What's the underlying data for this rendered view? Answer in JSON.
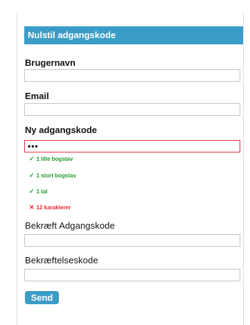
{
  "form": {
    "title": "Nulstil adgangskode",
    "fields": {
      "username_label": "Brugernavn",
      "username_value": "",
      "email_label": "Email",
      "email_value": "",
      "new_password_label": "Ny adgangskode",
      "new_password_value": "•••",
      "confirm_password_label": "Bekræft Adgangskode",
      "confirm_password_value": "",
      "confirm_code_label": "Bekræftelseskode",
      "confirm_code_value": ""
    },
    "password_rules": [
      {
        "mark": "✓",
        "text": "1 lille bogstav",
        "status": "ok"
      },
      {
        "mark": "✓",
        "text": "1 stort bogstav",
        "status": "ok"
      },
      {
        "mark": "✓",
        "text": "1 tal",
        "status": "ok"
      },
      {
        "mark": "✕",
        "text": "12 karakterer",
        "status": "fail"
      }
    ],
    "submit_label": "Send"
  },
  "colors": {
    "accent": "#3a9cc7",
    "ok": "#1e9a2a",
    "error": "#e3262d"
  }
}
